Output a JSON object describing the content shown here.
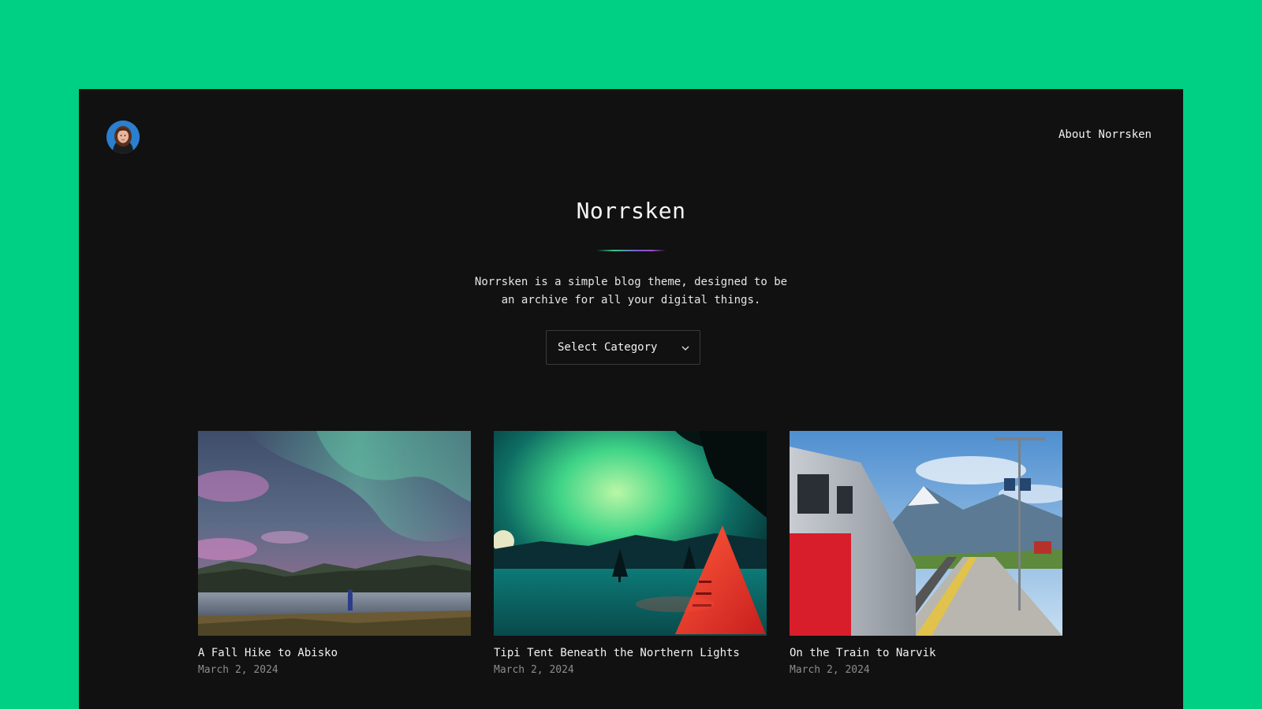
{
  "header": {
    "avatar_alt": "site avatar",
    "nav_link": "About Norrsken"
  },
  "hero": {
    "title": "Norrsken",
    "tagline": "Norrsken is a simple blog theme, designed to be an archive for all your digital things."
  },
  "category_select": {
    "selected": "Select Category"
  },
  "posts": [
    {
      "title": "A Fall Hike to Abisko",
      "date": "March 2, 2024",
      "image": "aurora-lake-photo"
    },
    {
      "title": "Tipi Tent Beneath the Northern Lights",
      "date": "March 2, 2024",
      "image": "aurora-tipi-photo"
    },
    {
      "title": "On the Train to Narvik",
      "date": "March 2, 2024",
      "image": "train-station-photo"
    }
  ],
  "colors": {
    "page_background": "#00d084",
    "frame_background": "#111111",
    "text": "#f2f2f2",
    "muted_text": "#8c8c8c"
  }
}
